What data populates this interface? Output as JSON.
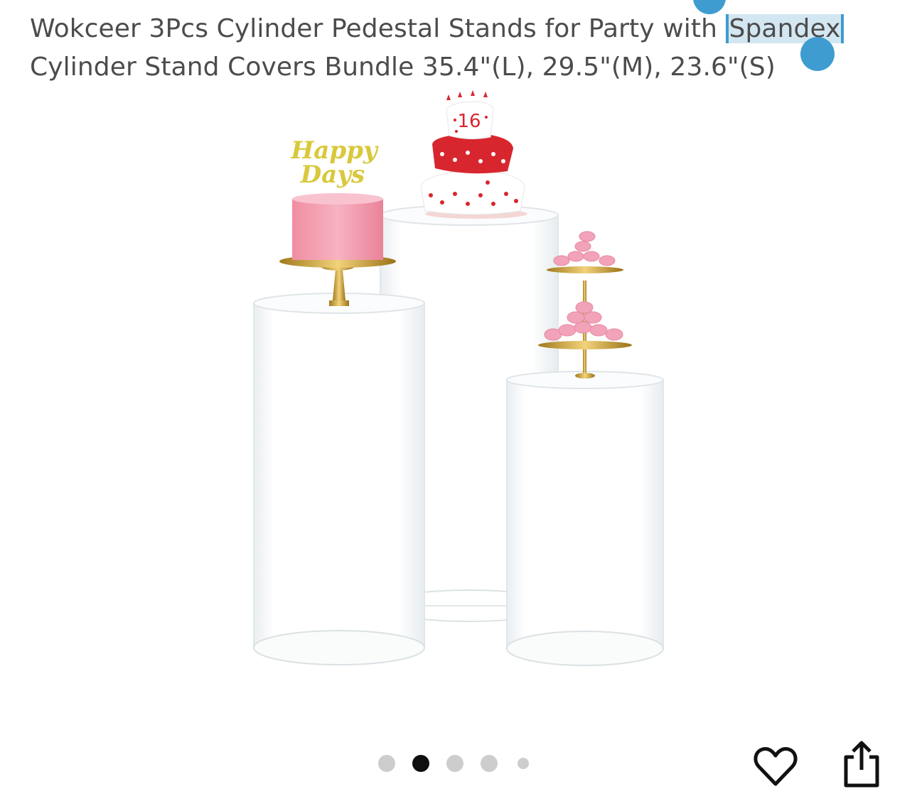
{
  "product": {
    "title_prefix": "Wokceer 3Pcs Cylinder Pedestal Stands for Party with ",
    "title_selected": "Spandex",
    "title_suffix": " Cylinder Stand Covers Bundle 35.4\"(L), 29.5\"(M), 23.6\"(S)"
  },
  "image": {
    "topper_line1": "Happy",
    "topper_line2": "Days",
    "cake_number": "16"
  },
  "carousel": {
    "count": 5,
    "active_index": 1
  },
  "icons": {
    "favorite": "heart-icon",
    "share": "share-icon"
  },
  "colors": {
    "selection_handle": "#3e9cd0",
    "selection_bg": "#d3e7f2",
    "dot_active": "#0f0f0f",
    "dot_inactive": "#cdcdcd"
  }
}
